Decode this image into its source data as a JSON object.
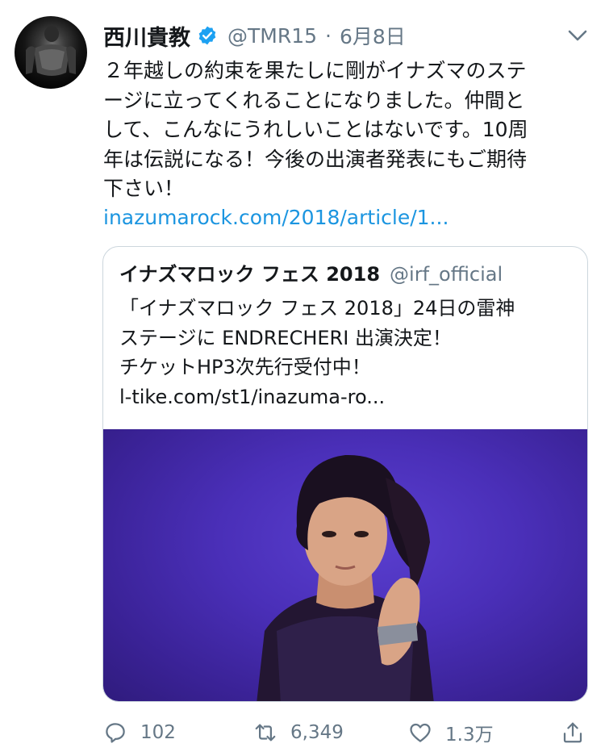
{
  "tweet": {
    "author_name": "西川貴教",
    "author_handle": "@TMR15",
    "separator": "·",
    "date": "6月8日",
    "text_lines": [
      "２年越しの約束を果たしに剛がイナズマのステ",
      "ージに立ってくれることになりました。仲間と",
      "して、こんなにうれしいことはないです。10周",
      "年は伝説になる！今後の出演者発表にもご期待",
      "下さい！"
    ],
    "link": "inazumarock.com/2018/article/1..."
  },
  "quoted": {
    "author_name": "イナズマロック フェス 2018",
    "author_handle": "@irf_official",
    "text_lines": [
      "「イナズマロック フェス 2018」24日の雷神",
      "ステージに ENDRECHERI 出演決定！",
      "チケットHP3次先行受付中！"
    ],
    "link": "l-tike.com/st1/inazuma-ro..."
  },
  "actions": {
    "reply_count": "102",
    "retweet_count": "6,349",
    "like_count": "1.3万"
  },
  "colors": {
    "text": "#14171a",
    "secondary": "#657786",
    "link": "#1b95e0",
    "verified": "#1da1f2",
    "card_border": "#ccd6dd",
    "image_background": "#4a2fb8"
  },
  "icons": [
    "avatar",
    "verified-badge-icon",
    "chevron-down-icon",
    "reply-icon",
    "retweet-icon",
    "like-icon",
    "share-icon"
  ]
}
